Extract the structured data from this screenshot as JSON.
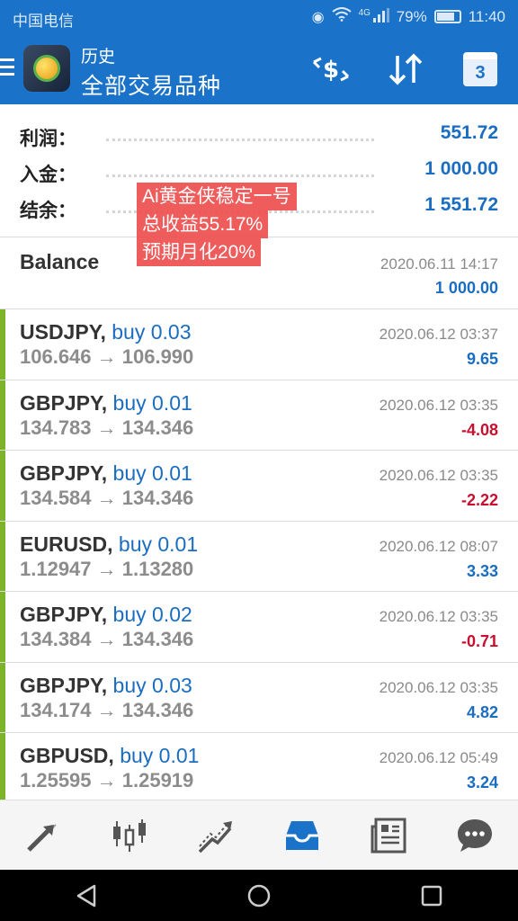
{
  "status_bar": {
    "carrier": "中国电信",
    "network": "4G",
    "battery": "79%",
    "battery_level": 0.79,
    "time": "11:40"
  },
  "header": {
    "subtitle": "历史",
    "title": "全部交易品种",
    "calendar_day": "3"
  },
  "summary": [
    {
      "label": "利润：",
      "value": "551.72"
    },
    {
      "label": "入金：",
      "value": "1 000.00"
    },
    {
      "label": "结余：",
      "value": "1 551.72"
    }
  ],
  "overlay": {
    "line1": "Ai黄金侠稳定一号",
    "line2": "总收益55.17%",
    "line3": "预期月化20%"
  },
  "balance": {
    "label": "Balance",
    "time": "2020.06.11 14:17",
    "amount": "1 000.00"
  },
  "deals": [
    {
      "symbol": "USDJPY,",
      "side": "buy 0.03",
      "prices": "106.646 → 106.990",
      "time": "2020.06.12 03:37",
      "profit": "9.65",
      "positive": true
    },
    {
      "symbol": "GBPJPY,",
      "side": "buy 0.01",
      "prices": "134.783 → 134.346",
      "time": "2020.06.12 03:35",
      "profit": "-4.08",
      "positive": false
    },
    {
      "symbol": "GBPJPY,",
      "side": "buy 0.01",
      "prices": "134.584 → 134.346",
      "time": "2020.06.12 03:35",
      "profit": "-2.22",
      "positive": false
    },
    {
      "symbol": "EURUSD,",
      "side": "buy 0.01",
      "prices": "1.12947 → 1.13280",
      "time": "2020.06.12 08:07",
      "profit": "3.33",
      "positive": true
    },
    {
      "symbol": "GBPJPY,",
      "side": "buy 0.02",
      "prices": "134.384 → 134.346",
      "time": "2020.06.12 03:35",
      "profit": "-0.71",
      "positive": false
    },
    {
      "symbol": "GBPJPY,",
      "side": "buy 0.03",
      "prices": "134.174 → 134.346",
      "time": "2020.06.12 03:35",
      "profit": "4.82",
      "positive": true
    },
    {
      "symbol": "GBPUSD,",
      "side": "buy 0.01",
      "prices": "1.25595 → 1.25919",
      "time": "2020.06.12 05:49",
      "profit": "3.24",
      "positive": true
    }
  ],
  "tabs": [
    {
      "icon": "trade-arrows-icon",
      "active": false
    },
    {
      "icon": "candlestick-chart-icon",
      "active": false
    },
    {
      "icon": "trend-chart-icon",
      "active": false
    },
    {
      "icon": "history-inbox-icon",
      "active": true
    },
    {
      "icon": "news-icon",
      "active": false
    },
    {
      "icon": "chat-icon",
      "active": false
    }
  ],
  "colors": {
    "header_bg": "#1a73c9",
    "positive": "#1a6dc0",
    "negative": "#c8102e",
    "deal_bar": "#7cb32a",
    "tab_active": "#1a73c9",
    "tab_inactive": "#555555"
  }
}
